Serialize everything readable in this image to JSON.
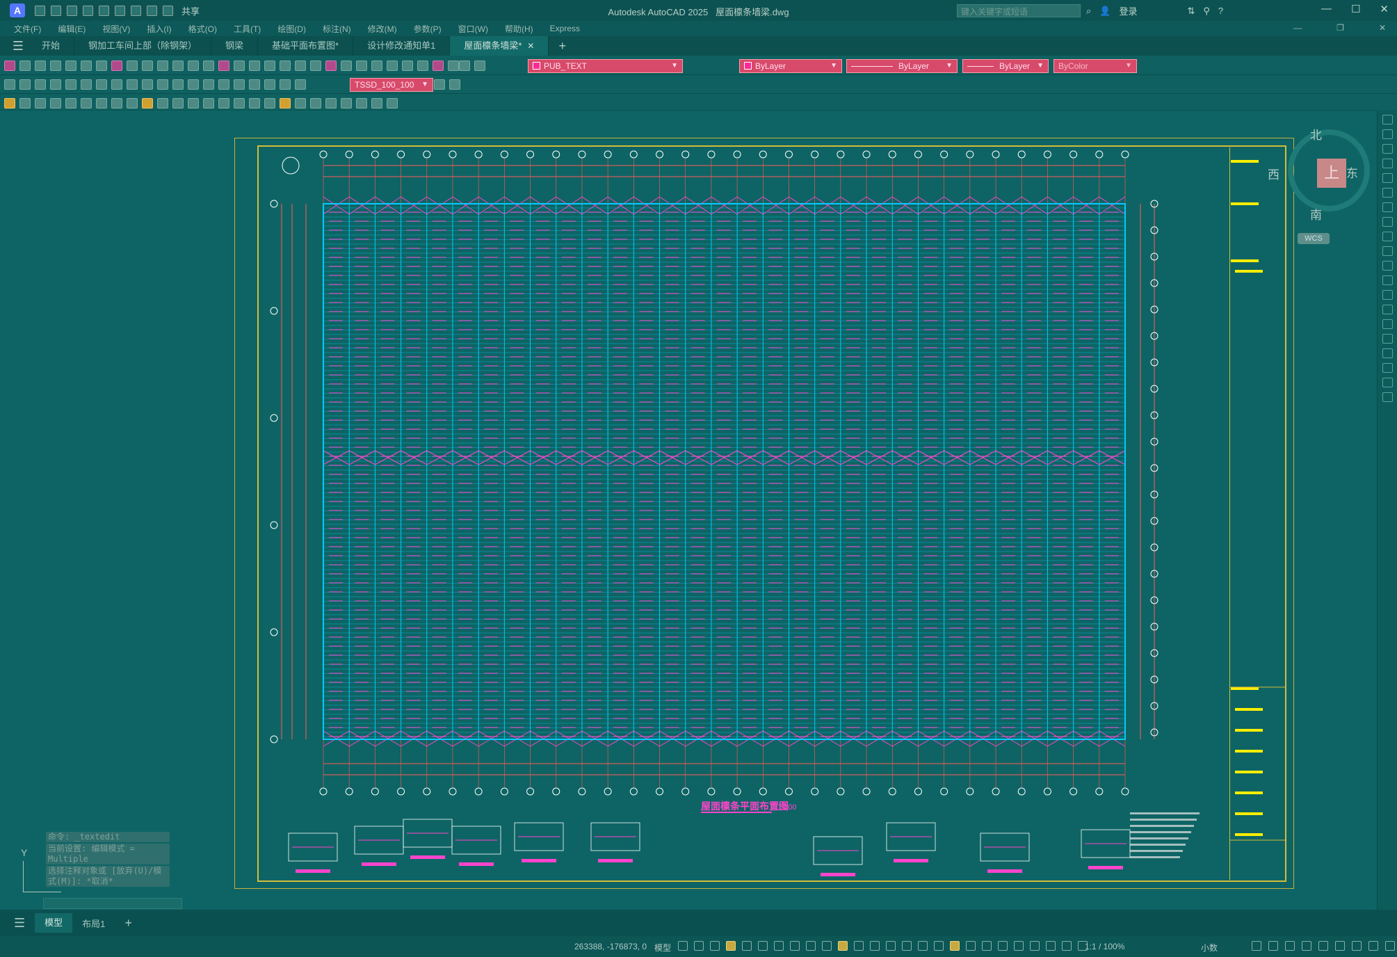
{
  "app": {
    "title": "Autodesk AutoCAD 2025",
    "file": "屋面檩条墙梁.dwg",
    "share_label": "共享",
    "search_placeholder": "键入关键字或短语",
    "login_label": "登录"
  },
  "menu": [
    "文件(F)",
    "编辑(E)",
    "视图(V)",
    "插入(I)",
    "格式(O)",
    "工具(T)",
    "绘图(D)",
    "标注(N)",
    "修改(M)",
    "参数(P)",
    "窗口(W)",
    "帮助(H)",
    "Express"
  ],
  "tabs": [
    {
      "label": "开始",
      "active": false,
      "closable": false
    },
    {
      "label": "钢加工车间上部（除钢架）",
      "active": false,
      "closable": false
    },
    {
      "label": "钢梁",
      "active": false,
      "closable": false
    },
    {
      "label": "基础平面布置图*",
      "active": false,
      "closable": false
    },
    {
      "label": "设计修改通知单1",
      "active": false,
      "closable": false
    },
    {
      "label": "屋面檩条墙梁*",
      "active": true,
      "closable": true
    }
  ],
  "toolbar": {
    "layer": "PUB_TEXT",
    "color": "ByLayer",
    "linetype": "ByLayer",
    "lineweight": "ByLayer",
    "plotstyle": "ByColor",
    "dimstyle": "TSSD_100_100"
  },
  "viewcube": {
    "top": "上",
    "north": "北",
    "south": "南",
    "east": "东",
    "west": "西",
    "wcs": "WCS"
  },
  "command": {
    "lines": [
      "命令: _textedit",
      "当前设置: 编辑模式 = Multiple",
      "选择注释对象或 [放弃(U)/模式(M)]: *取消*"
    ],
    "ucs_y": "Y"
  },
  "model_tabs": [
    {
      "label": "模型",
      "active": true
    },
    {
      "label": "布局1",
      "active": false
    }
  ],
  "status": {
    "coords": "263388, -176873, 0",
    "model_label": "模型",
    "scale": "1:1 / 100%",
    "units": "小数"
  },
  "drawing": {
    "title": "屋面檩条平面布置图",
    "title_scale": "1:100",
    "grid_cols": 31,
    "axis_rows": [
      "F",
      "E",
      "D",
      "C",
      "B",
      "A"
    ],
    "colors": {
      "bg": "#0e6464",
      "grid": "#00ccff",
      "purlin": "#ff44cc",
      "dim": "#ff5a5a",
      "frame": "#d4bd3a",
      "text": "#ffee00"
    }
  }
}
